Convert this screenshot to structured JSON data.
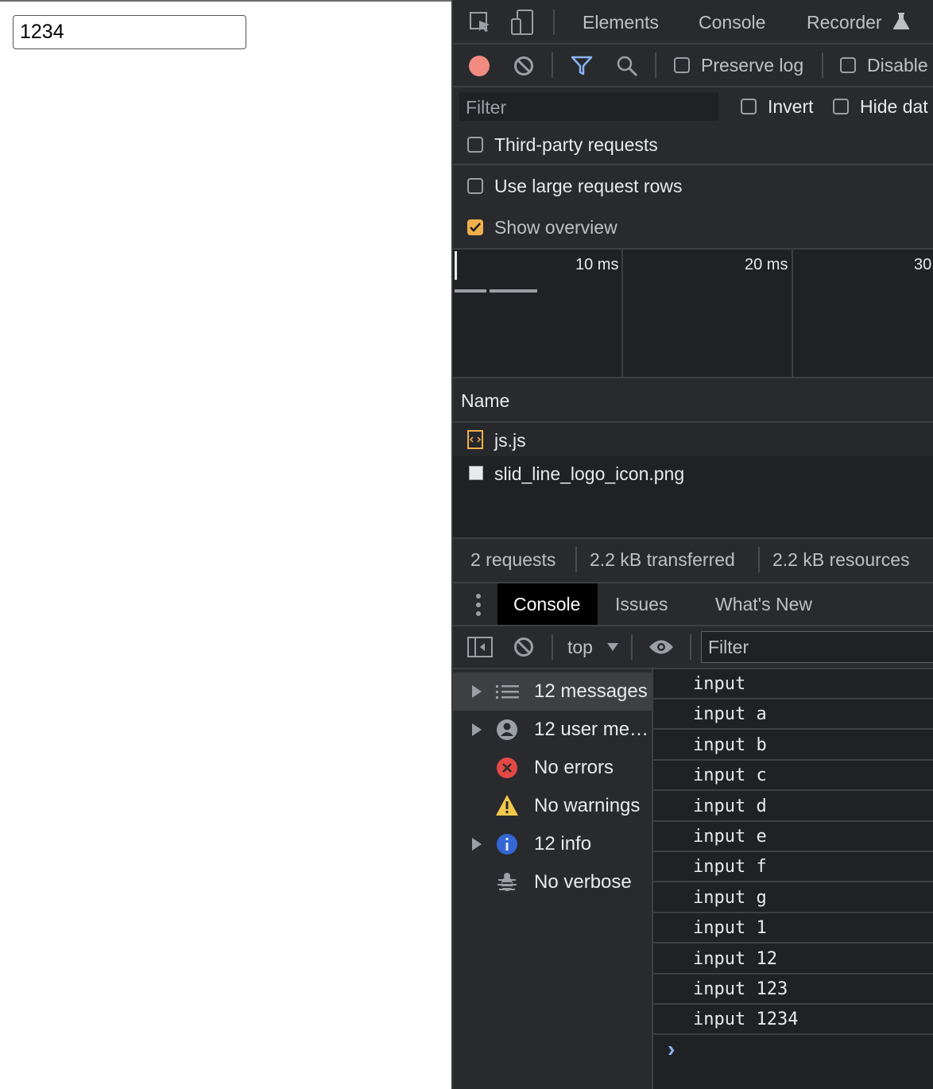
{
  "page": {
    "input_value": "1234"
  },
  "devtools": {
    "top_tabs": [
      "Elements",
      "Console",
      "Recorder"
    ],
    "network_toolbar": {
      "preserve_log": "Preserve log",
      "disable_cache": "Disable"
    },
    "filter": {
      "placeholder": "Filter",
      "invert": "Invert",
      "hide_data": "Hide dat"
    },
    "third_party": "Third-party requests",
    "large_rows": "Use large request rows",
    "show_overview": "Show overview",
    "timeline": {
      "ticks": [
        "10 ms",
        "20 ms",
        "30"
      ]
    },
    "requests": {
      "header": "Name",
      "rows": [
        {
          "name": "js.js",
          "icon": "script-file-icon"
        },
        {
          "name": "slid_line_logo_icon.png",
          "icon": "image-file-icon"
        }
      ]
    },
    "summary": {
      "requests": "2 requests",
      "transferred": "2.2 kB transferred",
      "resources": "2.2 kB resources"
    },
    "drawer_tabs": [
      "Console",
      "Issues",
      "What's New"
    ],
    "console_toolbar": {
      "context": "top",
      "filter_placeholder": "Filter"
    },
    "sidebar": [
      {
        "label": "12 messages",
        "icon": "list-icon",
        "expandable": true
      },
      {
        "label": "12 user me…",
        "icon": "user-icon",
        "expandable": true
      },
      {
        "label": "No errors",
        "icon": "error-icon",
        "expandable": false
      },
      {
        "label": "No warnings",
        "icon": "warning-icon",
        "expandable": false
      },
      {
        "label": "12 info",
        "icon": "info-icon",
        "expandable": true
      },
      {
        "label": "No verbose",
        "icon": "bug-icon",
        "expandable": false
      }
    ],
    "messages": [
      "input",
      "input a",
      "input b",
      "input c",
      "input d",
      "input e",
      "input f",
      "input g",
      "input 1",
      "input 12",
      "input 123",
      "input 1234"
    ],
    "prompt": "›"
  },
  "colors": {
    "accent_blue": "#8ab4f8",
    "record_red": "#f28b82",
    "checkbox_orange": "#f2ae4b",
    "error_red": "#e34845",
    "warning_yellow": "#f2c84b",
    "info_blue": "#3367d6"
  }
}
